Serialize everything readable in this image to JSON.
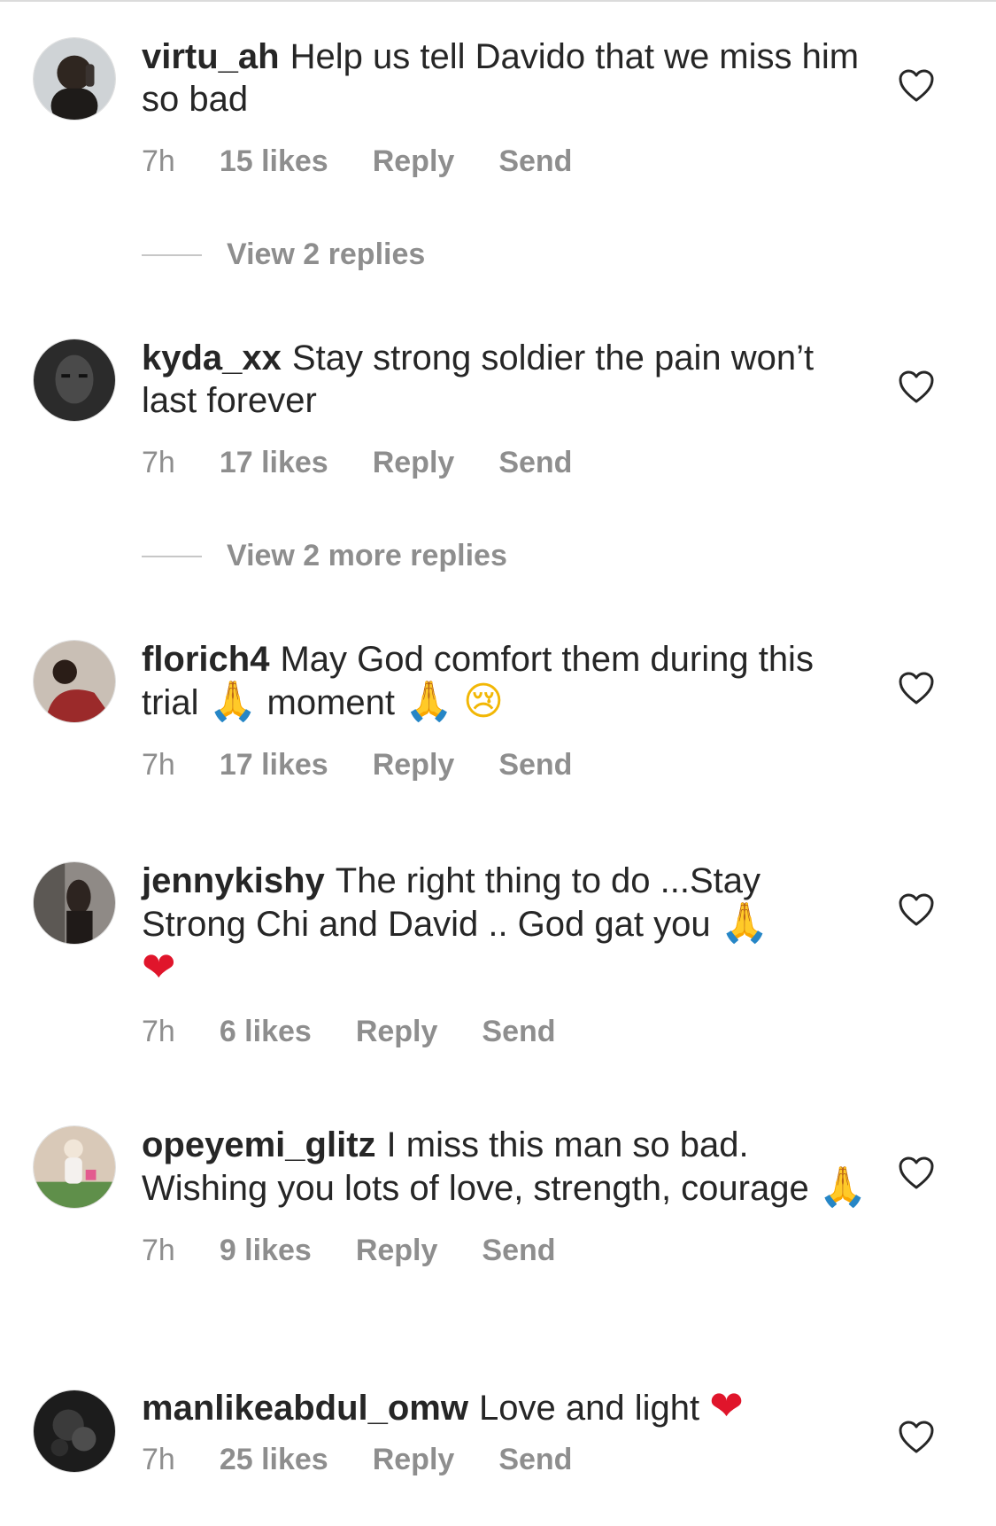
{
  "comments": [
    {
      "username": "virtu_ah",
      "text": "Help us tell Davido that we miss him so bad",
      "time": "7h",
      "likes": "15 likes",
      "reply": "Reply",
      "send": "Send",
      "view_replies": "View 2 replies"
    },
    {
      "username": "kyda_xx",
      "text": "Stay strong soldier the pain won’t last forever",
      "time": "7h",
      "likes": "17 likes",
      "reply": "Reply",
      "send": "Send",
      "view_replies": "View 2 more replies"
    },
    {
      "username": "florich4",
      "text_1": "May God comfort them during this trial",
      "text_2": "moment",
      "emoji_1": "🙏",
      "emoji_2": "🙏",
      "emoji_3": "😢",
      "time": "7h",
      "likes": "17 likes",
      "reply": "Reply",
      "send": "Send"
    },
    {
      "username": "jennykishy",
      "text": "The right thing to do ...Stay Strong Chi and David .. God gat you",
      "emoji_1": "🙏",
      "emoji_2": "❤",
      "time": "7h",
      "likes": "6 likes",
      "reply": "Reply",
      "send": "Send"
    },
    {
      "username": "opeyemi_glitz",
      "text": "I miss this man so bad. Wishing you lots of love, strength, courage",
      "emoji_1": "🙏",
      "time": "7h",
      "likes": "9 likes",
      "reply": "Reply",
      "send": "Send"
    },
    {
      "username": "manlikeabdul_omw",
      "text": "Love and light",
      "emoji_1": "❤",
      "time": "7h",
      "likes": "25 likes",
      "reply": "Reply",
      "send": "Send"
    }
  ],
  "icons": {
    "like": "heart-outline-icon",
    "praying_hands": "praying-hands-icon",
    "red_heart": "red-heart-icon",
    "crying_face": "crying-face-icon"
  },
  "colors": {
    "text": "#262626",
    "secondary": "#8e8e8e",
    "emoji_heart": "#e0152b"
  }
}
